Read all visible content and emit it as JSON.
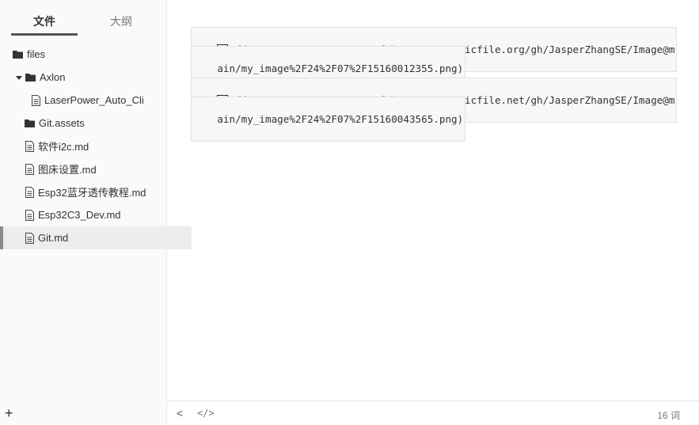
{
  "sidebar": {
    "tabs": [
      {
        "label": "文件"
      },
      {
        "label": "大纲"
      }
    ],
    "tree": [
      {
        "label": "files",
        "type": "folder"
      },
      {
        "label": "Axlon",
        "type": "folder"
      },
      {
        "label": "LaserPower_Auto_Cli",
        "type": "file"
      },
      {
        "label": "Git.assets",
        "type": "folder"
      },
      {
        "label": "软件i2c.md",
        "type": "file"
      },
      {
        "label": "图床设置.md",
        "type": "file"
      },
      {
        "label": "Esp32蓝牙透传教程.md",
        "type": "file"
      },
      {
        "label": "Esp32C3_Dev.md",
        "type": "file"
      },
      {
        "label": "Git.md",
        "type": "file",
        "active": true
      }
    ],
    "add_label": "+"
  },
  "editor": {
    "images": [
      {
        "line1": "![image-20240715160010683](https://staticfile.org/gh/JasperZhangSE/Image@m",
        "line2": "ain/my_image%2F24%2F07%2F15160012355.png)"
      },
      {
        "line1": "![image-20240715160041311](https://staticfile.net/gh/JasperZhangSE/Image@m",
        "line2": "ain/my_image%2F24%2F07%2F15160043565.png)"
      }
    ]
  },
  "footer": {
    "back_label": "<",
    "source_label": "</>",
    "word_count": "16 词"
  },
  "icons": {
    "folder": "folder-icon",
    "file": "file-icon",
    "image": "broken-image-icon",
    "caret": "caret-down-icon"
  }
}
